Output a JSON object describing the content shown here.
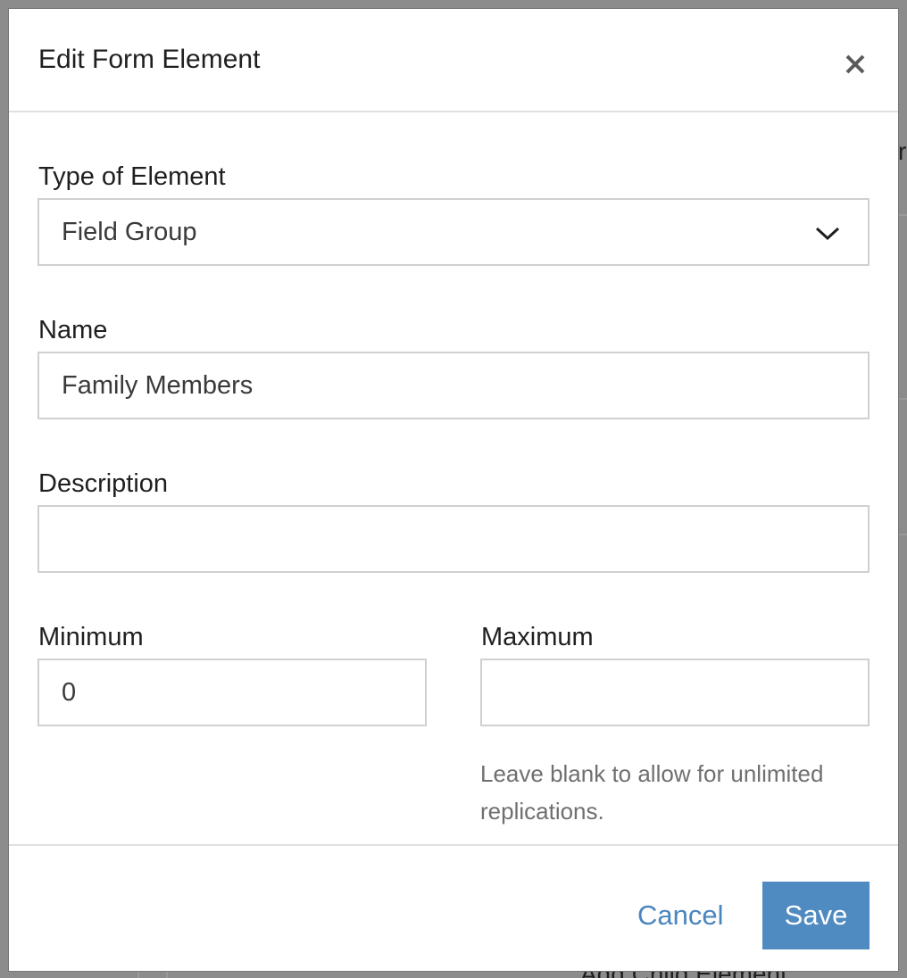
{
  "background": {
    "peek_right_text": "r",
    "peek_bottom_text": "Add Child Element"
  },
  "modal": {
    "title": "Edit Form Element",
    "close_icon": "close-icon"
  },
  "form": {
    "type": {
      "label": "Type of Element",
      "selected": "Field Group",
      "icon": "chevron-down-icon"
    },
    "name": {
      "label": "Name",
      "value": "Family Members"
    },
    "description": {
      "label": "Description",
      "value": ""
    },
    "minimum": {
      "label": "Minimum",
      "value": "0"
    },
    "maximum": {
      "label": "Maximum",
      "value": "",
      "helper": "Leave blank to allow for unlimited replications."
    }
  },
  "footer": {
    "cancel_label": "Cancel",
    "save_label": "Save"
  },
  "colors": {
    "accent": "#4f8ac0",
    "link": "#4a86bd",
    "overlay": "#8c8c8c"
  }
}
